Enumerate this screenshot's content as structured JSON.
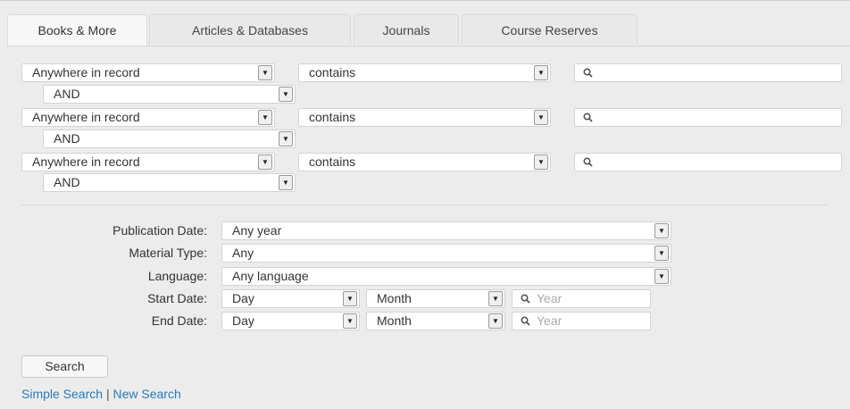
{
  "tabs": [
    {
      "label": "Books & More",
      "active": true
    },
    {
      "label": "Articles & Databases",
      "active": false
    },
    {
      "label": "Journals",
      "active": false
    },
    {
      "label": "Course Reserves",
      "active": false
    }
  ],
  "search_rows": [
    {
      "field": "Anywhere in record",
      "operator": "contains",
      "query": "",
      "boolean": "AND"
    },
    {
      "field": "Anywhere in record",
      "operator": "contains",
      "query": "",
      "boolean": "AND"
    },
    {
      "field": "Anywhere in record",
      "operator": "contains",
      "query": "",
      "boolean": "AND"
    }
  ],
  "filters": {
    "publication_date": {
      "label": "Publication Date:",
      "value": "Any year"
    },
    "material_type": {
      "label": "Material Type:",
      "value": "Any"
    },
    "language": {
      "label": "Language:",
      "value": "Any language"
    },
    "start_date": {
      "label": "Start Date:",
      "day": "Day",
      "month": "Month",
      "year_placeholder": "Year"
    },
    "end_date": {
      "label": "End Date:",
      "day": "Day",
      "month": "Month",
      "year_placeholder": "Year"
    }
  },
  "search_button": "Search",
  "links": {
    "simple": "Simple Search",
    "separator": "|",
    "new": "New Search"
  },
  "icons": {
    "dropdown": "dropdown-arrow-icon",
    "search": "magnifier-icon"
  },
  "colors": {
    "link": "#2a7ab8",
    "background": "#ececec"
  }
}
